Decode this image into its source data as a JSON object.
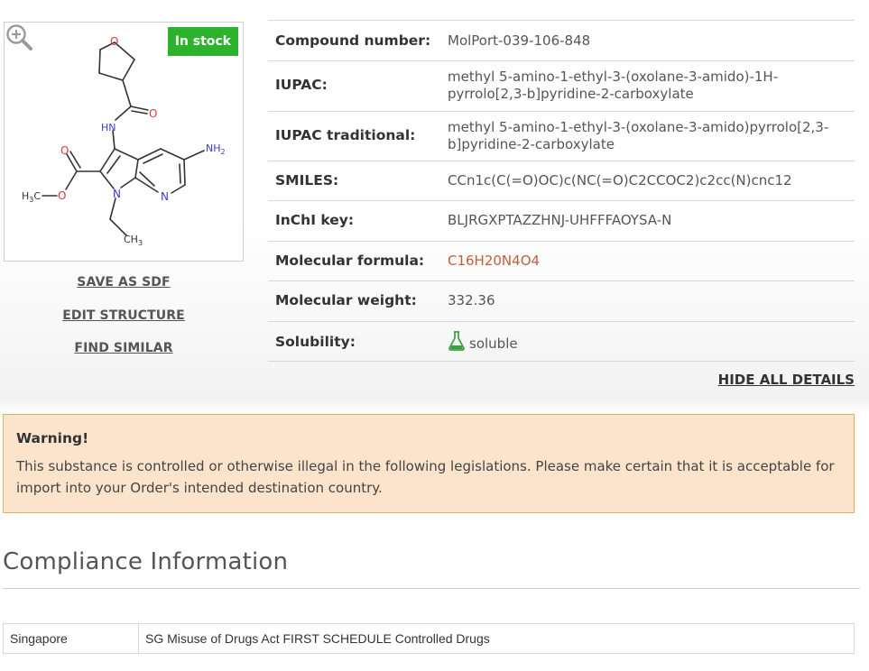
{
  "structure": {
    "stock_badge": "In stock",
    "zoom_icon": "zoom-in-icon",
    "atoms": {
      "o_ring": "O",
      "o_amide": "O",
      "hn": "HN",
      "nh2": "NH",
      "nh2_sub": "2",
      "o_ester_carbonyl": "O",
      "h3c": "H",
      "h3c_sub": "3",
      "h3c_c": "C",
      "o_ester": "O",
      "n_pyrrole": "N",
      "n_pyridine": "N",
      "ch3": "CH",
      "ch3_sub": "3"
    }
  },
  "actions": {
    "save_sdf": "SAVE AS SDF",
    "edit_structure": "EDIT STRUCTURE",
    "find_similar": "FIND SIMILAR"
  },
  "properties": [
    {
      "label": "Compound number:",
      "value": "MolPort-039-106-848"
    },
    {
      "label": "IUPAC:",
      "value": "methyl 5-amino-1-ethyl-3-(oxolane-3-amido)-1H-pyrrolo[2,3-b]pyridine-2-carboxylate"
    },
    {
      "label": "IUPAC traditional:",
      "value": "methyl 5-amino-1-ethyl-3-(oxolane-3-amido)pyrrolo[2,3-b]pyridine-2-carboxylate"
    },
    {
      "label": "SMILES:",
      "value": "CCn1c(C(=O)OC)c(NC(=O)C2CCOC2)c2cc(N)cnc12"
    },
    {
      "label": "InChI key:",
      "value": "BLJRGXPTAZZHNJ-UHFFFAOYSA-N"
    },
    {
      "label": "Molecular formula:",
      "value": "C16H20N4O4"
    },
    {
      "label": "Molecular weight:",
      "value": "332.36"
    },
    {
      "label": "Solubility:",
      "value": "soluble",
      "icon": "flask-icon"
    }
  ],
  "hide_details": "HIDE ALL DETAILS",
  "warning": {
    "title": "Warning!",
    "text": "This substance is controlled or otherwise illegal in the following legislations. Please make certain that it is acceptable for import into your Order's intended destination country."
  },
  "compliance": {
    "title": "Compliance Information",
    "rows": [
      {
        "country": "Singapore",
        "regulation": "SG Misuse of Drugs Act FIRST SCHEDULE Controlled Drugs"
      }
    ]
  },
  "colors": {
    "in_stock": "#2db22d",
    "formula": "#c0603a",
    "warning_bg": "#fbe3cc",
    "warning_border": "#dfb15f",
    "atom_o": "#d8383d",
    "atom_n": "#3a3ad0"
  }
}
